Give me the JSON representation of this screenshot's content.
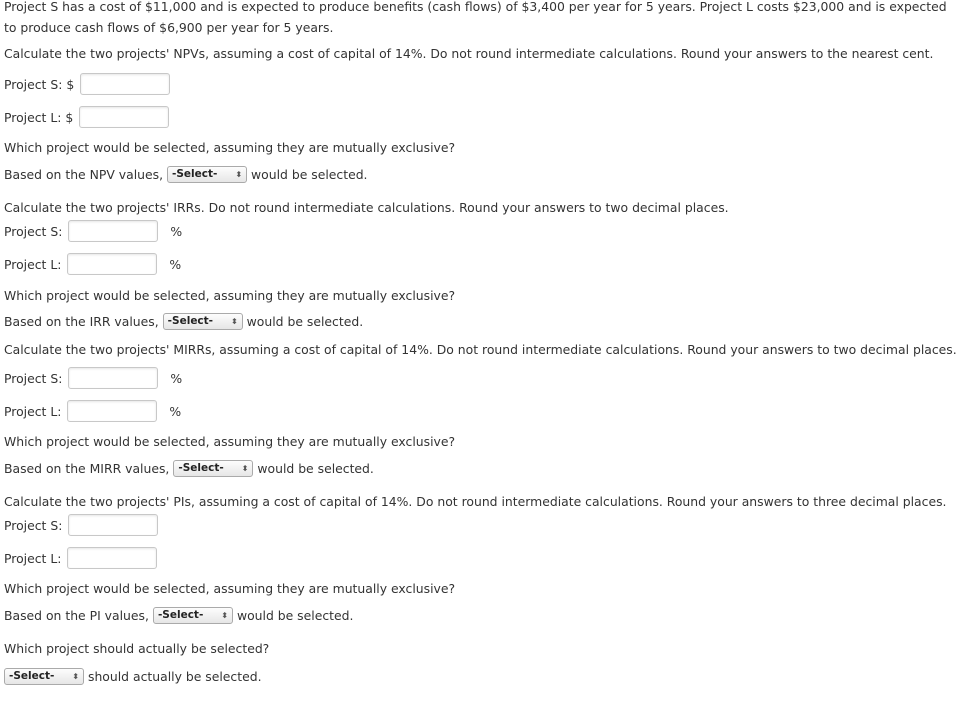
{
  "intro": "Project S has a cost of $11,000 and is expected to produce benefits (cash flows) of $3,400 per year for 5 years. Project L costs $23,000 and is expected to produce cash flows of $6,900 per year for 5 years.",
  "select_label": "-Select-",
  "which_mutual": "Which project would be selected, assuming they are mutually exclusive?",
  "would_be_selected": "would be selected.",
  "project_s": "Project S:",
  "project_l": "Project L:",
  "dollar": "$",
  "percent": "%",
  "npv": {
    "instruction": "Calculate the two projects' NPVs, assuming a cost of capital of 14%. Do not round intermediate calculations. Round your answers to the nearest cent.",
    "based": "Based on the NPV values,"
  },
  "irr": {
    "instruction": "Calculate the two projects' IRRs. Do not round intermediate calculations. Round your answers to two decimal places.",
    "based": "Based on the IRR values,"
  },
  "mirr": {
    "instruction": "Calculate the two projects' MIRRs, assuming a cost of capital of 14%. Do not round intermediate calculations. Round your answers to two decimal places.",
    "based": "Based on the MIRR values,"
  },
  "pi": {
    "instruction": "Calculate the two projects' PIs, assuming a cost of capital of 14%. Do not round intermediate calculations. Round your answers to three decimal places.",
    "based": "Based on the PI values,"
  },
  "actual": {
    "question": "Which project should actually be selected?",
    "suffix": "should actually be selected."
  }
}
